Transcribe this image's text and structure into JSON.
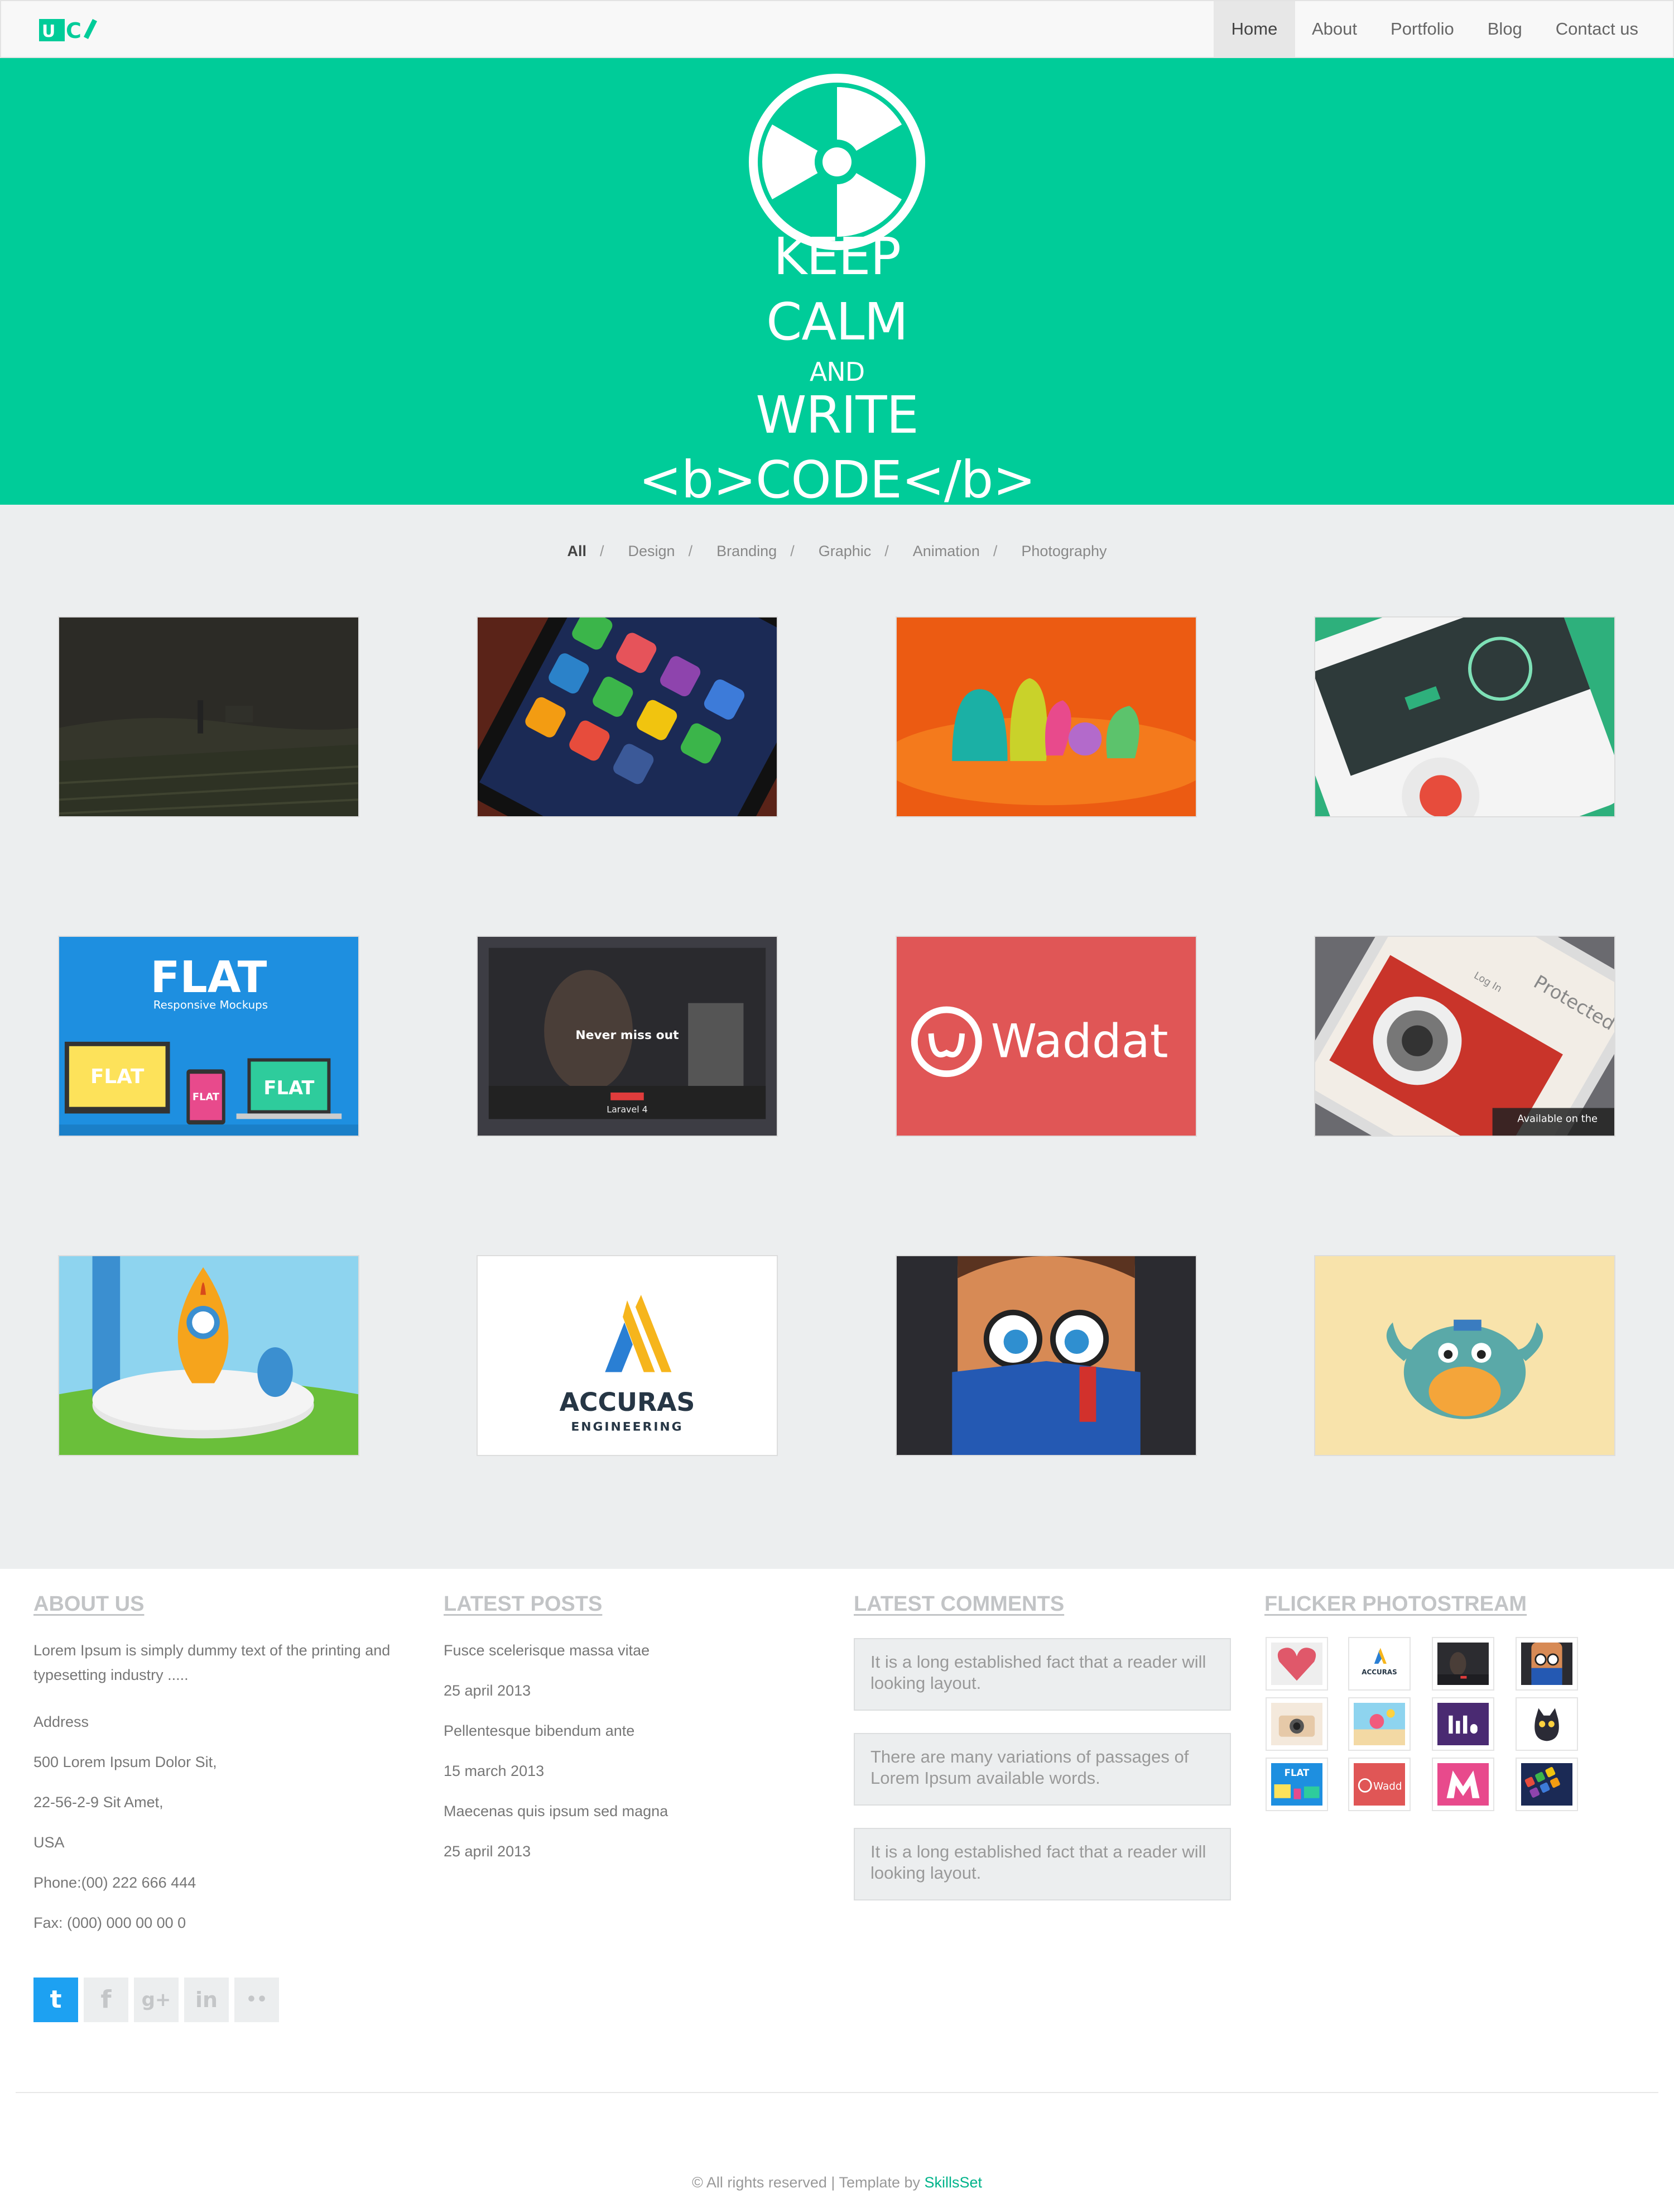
{
  "brand": {
    "logo_text": "UC",
    "accent_color": "#00cc99"
  },
  "nav": {
    "items": [
      {
        "label": "Home",
        "active": true
      },
      {
        "label": "About"
      },
      {
        "label": "Portfolio"
      },
      {
        "label": "Blog"
      },
      {
        "label": "Contact us"
      }
    ]
  },
  "hero": {
    "icon": "radiation-icon",
    "lines": [
      "KEEP",
      "CALM",
      "AND",
      "WRITE",
      "<b>CODE</b>"
    ]
  },
  "filters": [
    "All",
    "Design",
    "Branding",
    "Graphic",
    "Animation",
    "Photography"
  ],
  "gallery": {
    "items": [
      {
        "name": "dark-vineyard-photo"
      },
      {
        "name": "phone-app-icons"
      },
      {
        "name": "clay-characters"
      },
      {
        "name": "green-phone-app"
      },
      {
        "name": "flat-responsive-mockups",
        "text": [
          "FLAT",
          "Responsive Mockups",
          "FLAT",
          "FLAT",
          "FLAT"
        ]
      },
      {
        "name": "website-slider-screenshot",
        "text": [
          "Never miss out",
          "Laravel 4"
        ]
      },
      {
        "name": "waddat-logo",
        "text": [
          "Waddat"
        ]
      },
      {
        "name": "camera-login-app",
        "text": [
          "Protected",
          "Log In",
          "Available on the"
        ]
      },
      {
        "name": "rocket-illustration"
      },
      {
        "name": "accuras-engineering-logo",
        "text": [
          "ACCURAS",
          "ENGINEERING"
        ]
      },
      {
        "name": "reading-nerd-icon"
      },
      {
        "name": "crab-monster-illustration"
      }
    ]
  },
  "footer": {
    "about": {
      "title": "ABOUT US",
      "lines": [
        "Lorem Ipsum is simply dummy text of the printing and",
        "typesetting industry .....",
        "Address",
        "500 Lorem Ipsum Dolor Sit,",
        "22-56-2-9 Sit Amet,",
        "USA",
        "Phone:(00) 222 666 444",
        "Fax: (000) 000 00 00 0"
      ]
    },
    "posts": {
      "title": "LATEST POSTS",
      "items": [
        {
          "title": "Fusce scelerisque massa vitae",
          "date": "25 april 2013"
        },
        {
          "title": "Pellentesque bibendum ante",
          "date": "15 march 2013"
        },
        {
          "title": "Maecenas quis ipsum sed magna",
          "date": "25 april 2013"
        }
      ]
    },
    "comments": {
      "title": "LATEST COMMENTS",
      "items": [
        "It is a long established fact that a reader will looking layout.",
        "There are many variations of passages of Lorem Ipsum available words.",
        "It is a long established fact that a reader will looking layout."
      ]
    },
    "flickr": {
      "title": "FLICKER PHOTOSTREAM",
      "items": [
        {
          "name": "flickr-heart"
        },
        {
          "name": "flickr-accuras",
          "text": "ACCURAS"
        },
        {
          "name": "flickr-website"
        },
        {
          "name": "flickr-nerd"
        },
        {
          "name": "flickr-camera"
        },
        {
          "name": "flickr-beach"
        },
        {
          "name": "flickr-purple-logo"
        },
        {
          "name": "flickr-black-cat"
        },
        {
          "name": "flickr-flat",
          "text": "FLAT"
        },
        {
          "name": "flickr-waddat",
          "text": "Wadd"
        },
        {
          "name": "flickr-m-logo"
        },
        {
          "name": "flickr-app-icons"
        }
      ]
    },
    "social": [
      {
        "name": "twitter-icon",
        "glyph": "t"
      },
      {
        "name": "facebook-icon",
        "glyph": "f"
      },
      {
        "name": "google-plus-icon",
        "glyph": "g+"
      },
      {
        "name": "linkedin-icon",
        "glyph": "in"
      },
      {
        "name": "flickr-icon",
        "glyph": "••"
      }
    ],
    "copyright": {
      "text": "© All rights reserved | Template by ",
      "link": "SkillsSet"
    }
  }
}
